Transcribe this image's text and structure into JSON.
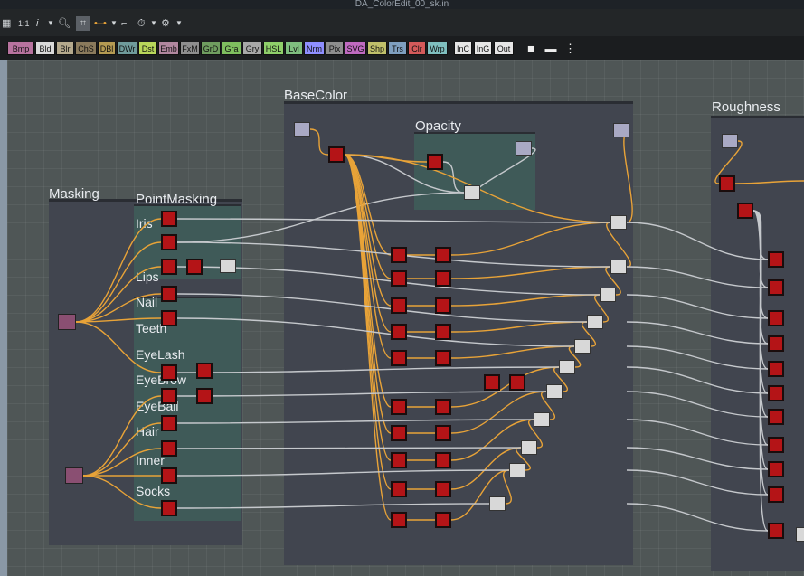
{
  "window": {
    "title": "DA_ColorEdit_00_sk.in"
  },
  "toolbar": {
    "zoom_label": "1:1",
    "info_label": "i"
  },
  "chips": [
    {
      "label": "Bmp",
      "color": "#b8739f"
    },
    {
      "label": "Bld",
      "color": "#d9d9d9"
    },
    {
      "label": "Blr",
      "color": "#b4a98d"
    },
    {
      "label": "ChS",
      "color": "#8a7a5c"
    },
    {
      "label": "DBl",
      "color": "#b49a52"
    },
    {
      "label": "DWr",
      "color": "#6f9b9b"
    },
    {
      "label": "Dst",
      "color": "#b8d65a"
    },
    {
      "label": "Emb",
      "color": "#b1879f"
    },
    {
      "label": "FxM",
      "color": "#8e8e8e"
    },
    {
      "label": "GrD",
      "color": "#6f9d5f"
    },
    {
      "label": "Gra",
      "color": "#7fbf5f"
    },
    {
      "label": "Gry",
      "color": "#a8a8a8"
    },
    {
      "label": "HSL",
      "color": "#8fcf6a"
    },
    {
      "label": "Lvl",
      "color": "#7fbf7f"
    },
    {
      "label": "Nrm",
      "color": "#8f8fff"
    },
    {
      "label": "Pix",
      "color": "#8e8e8e"
    },
    {
      "label": "SVG",
      "color": "#c06ac0"
    },
    {
      "label": "Shp",
      "color": "#c0c06a"
    },
    {
      "label": "Trs",
      "color": "#7f9fbf"
    },
    {
      "label": "Clr",
      "color": "#d45a5a"
    },
    {
      "label": "Wrp",
      "color": "#7fbfbf"
    },
    {
      "label": "InC",
      "color": "#e6e6e6"
    },
    {
      "label": "InG",
      "color": "#e6e6e6"
    },
    {
      "label": "Out",
      "color": "#e6e6e6"
    }
  ],
  "graph": {
    "groups": {
      "masking": "Masking",
      "point_masking": "PointMasking",
      "basecolor": "BaseColor",
      "opacity": "Opacity",
      "roughness": "Roughness"
    },
    "mask_labels": [
      "Iris",
      "Lips",
      "Nail",
      "Teeth",
      "EyeLash",
      "EyeBrow",
      "EyeBall",
      "Hair",
      "Inner",
      "Socks"
    ]
  },
  "colors": {
    "node_red": "#b41417",
    "wire_orange": "#e8a338",
    "wire_gray": "#c5c8cc",
    "group_bg": "#41454f"
  }
}
